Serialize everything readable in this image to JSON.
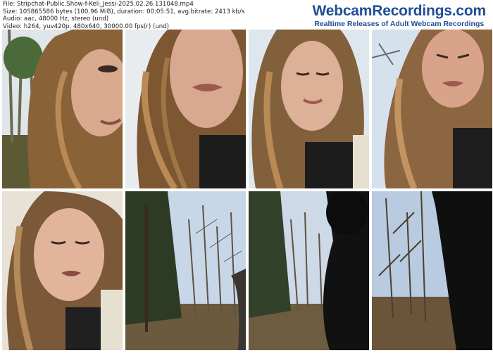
{
  "file_info": {
    "line1": "File: Stripchat-Public.Show-f-Keli_Jessi-2025.02.26.131048.mp4",
    "line2": "Size: 105865586 bytes (100.96 MiB), duration: 00:05:51, avg.bitrate: 2413 kb/s",
    "line3": "Audio: aac, 48000 Hz, stereo (und)",
    "line4": "Video: h264, yuv420p, 480x640, 30000.00 fps(r) (und)"
  },
  "brand": {
    "title": "WebcamRecordings.com",
    "subtitle": "Realtime Releases of Adult Webcam Recordings"
  },
  "thumbnails": [
    {
      "scene": "face-closeup-trees",
      "sky": "#dfe6ea",
      "hair": "#8a6238",
      "skin": "#d9a98e",
      "shirt": "#1a1a1a"
    },
    {
      "scene": "face-lowangle",
      "sky": "#e9ecef",
      "hair": "#7d5632",
      "skin": "#d8a891",
      "shirt": "#1d1d1d"
    },
    {
      "scene": "face-eyes-closed",
      "sky": "#dfe7ee",
      "hair": "#83603c",
      "skin": "#ddb098",
      "shirt": "#1c1c1c"
    },
    {
      "scene": "face-looking-up",
      "sky": "#d5e2ee",
      "hair": "#8b6640",
      "skin": "#d9a38a",
      "shirt": "#1e1e1e"
    },
    {
      "scene": "face-sunlit",
      "sky": "#e8e2d6",
      "hair": "#7a5838",
      "skin": "#e2b49c",
      "shirt": "#202020"
    },
    {
      "scene": "forest-pines",
      "sky": "#c8d7e8",
      "trees": "#2d3b24",
      "ground": "#6b5a3e"
    },
    {
      "scene": "forest-dark-figure",
      "sky": "#cdd9e6",
      "trees": "#33402a",
      "ground": "#6e5c40"
    },
    {
      "scene": "bare-trees-figure",
      "sky": "#b9cbe0",
      "trees": "#4a4030",
      "ground": "#6a553a"
    }
  ]
}
